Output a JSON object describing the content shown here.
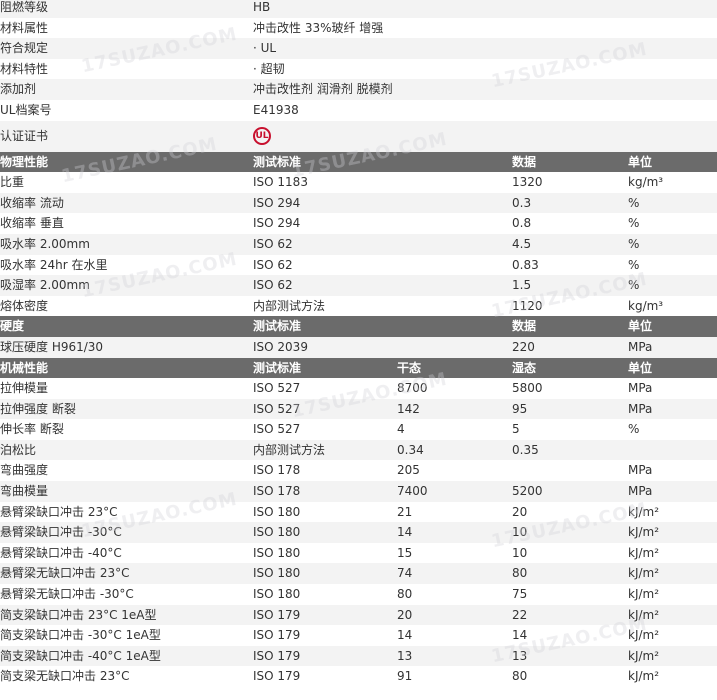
{
  "info_rows": [
    {
      "label": "阻燃等级",
      "value": "HB"
    },
    {
      "label": "材料属性",
      "value": "冲击改性 33%玻纤 增强"
    },
    {
      "label": "符合规定",
      "value": "· UL"
    },
    {
      "label": "材料特性",
      "value": "· 超韧"
    },
    {
      "label": "添加剂",
      "value": "冲击改性剂 润滑剂 脱模剂"
    },
    {
      "label": "UL档案号",
      "value": "E41938"
    }
  ],
  "cert": {
    "label": "认证证书",
    "logo_text": "UL"
  },
  "physical": {
    "header": [
      "物理性能",
      "测试标准",
      "",
      "数据",
      "单位"
    ],
    "rows": [
      [
        "比重",
        "ISO 1183",
        "",
        "1320",
        "kg/m³"
      ],
      [
        "收缩率   流动",
        "ISO 294",
        "",
        "0.3",
        "%"
      ],
      [
        "收缩率   垂直",
        "ISO 294",
        "",
        "0.8",
        "%"
      ],
      [
        "吸水率   2.00mm",
        "ISO 62",
        "",
        "4.5",
        "%"
      ],
      [
        "吸水率   24hr 在水里",
        "ISO 62",
        "",
        "0.83",
        "%"
      ],
      [
        "吸湿率   2.00mm",
        "ISO 62",
        "",
        "1.5",
        "%"
      ],
      [
        "熔体密度",
        "内部测试方法",
        "",
        "1120",
        "kg/m³"
      ]
    ]
  },
  "hardness": {
    "header": [
      "硬度",
      "测试标准",
      "",
      "数据",
      "单位"
    ],
    "rows": [
      [
        "球压硬度   H961/30",
        "ISO 2039",
        "",
        "220",
        "MPa"
      ]
    ]
  },
  "mechanical": {
    "header": [
      "机械性能",
      "测试标准",
      "干态",
      "湿态",
      "单位"
    ],
    "rows": [
      [
        "拉伸模量",
        "ISO 527",
        "8700",
        "5800",
        "MPa"
      ],
      [
        "拉伸强度   断裂",
        "ISO 527",
        "142",
        "95",
        "MPa"
      ],
      [
        "伸长率   断裂",
        "ISO 527",
        "4",
        "5",
        "%"
      ],
      [
        "泊松比",
        "内部测试方法",
        "0.34",
        "0.35",
        ""
      ],
      [
        "弯曲强度",
        "ISO 178",
        "205",
        "",
        "MPa"
      ],
      [
        "弯曲模量",
        "ISO 178",
        "7400",
        "5200",
        "MPa"
      ],
      [
        "悬臂梁缺口冲击   23°C",
        "ISO 180",
        "21",
        "20",
        "kJ/m²"
      ],
      [
        "悬臂梁缺口冲击   -30°C",
        "ISO 180",
        "14",
        "10",
        "kJ/m²"
      ],
      [
        "悬臂梁缺口冲击   -40°C",
        "ISO 180",
        "15",
        "10",
        "kJ/m²"
      ],
      [
        "悬臂梁无缺口冲击   23°C",
        "ISO 180",
        "74",
        "80",
        "kJ/m²"
      ],
      [
        "悬臂梁无缺口冲击   -30°C",
        "ISO 180",
        "80",
        "75",
        "kJ/m²"
      ],
      [
        "简支梁缺口冲击   23°C 1eA型",
        "ISO 179",
        "20",
        "22",
        "kJ/m²"
      ],
      [
        "简支梁缺口冲击   -30°C 1eA型",
        "ISO 179",
        "14",
        "14",
        "kJ/m²"
      ],
      [
        "简支梁缺口冲击   -40°C 1eA型",
        "ISO 179",
        "13",
        "13",
        "kJ/m²"
      ],
      [
        "简支梁无缺口冲击   23°C",
        "ISO 179",
        "91",
        "80",
        "kJ/m²"
      ]
    ]
  },
  "watermark": "17SUZAO.COM"
}
